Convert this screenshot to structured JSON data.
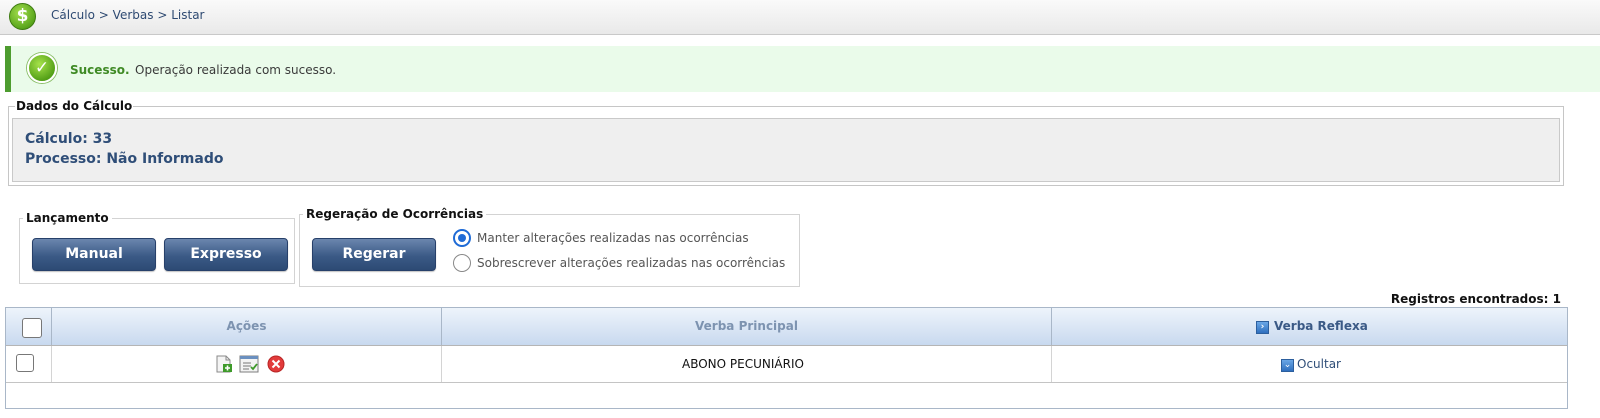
{
  "breadcrumb": {
    "items": [
      "Cálculo",
      "Verbas",
      "Listar"
    ],
    "separator": ">"
  },
  "alert": {
    "title": "Sucesso.",
    "message": "Operação realizada com sucesso."
  },
  "dados": {
    "legend": "Dados do Cálculo",
    "calculo": "Cálculo: 33",
    "processo": "Processo: Não Informado"
  },
  "lancamento": {
    "legend": "Lançamento",
    "manual": "Manual",
    "expresso": "Expresso"
  },
  "regeracao": {
    "legend": "Regeração de Ocorrências",
    "button": "Regerar",
    "options": [
      {
        "label": "Manter alterações realizadas nas ocorrências",
        "checked": true
      },
      {
        "label": "Sobrescrever alterações realizadas nas ocorrências",
        "checked": false
      }
    ]
  },
  "registros": "Registros encontrados: 1",
  "table": {
    "headers": {
      "acoes": "Ações",
      "principal": "Verba Principal",
      "reflexa": "Verba Reflexa"
    },
    "rows": [
      {
        "principal": "ABONO PECUNIÁRIO",
        "reflexa_link": "Ocultar"
      }
    ]
  },
  "colors": {
    "accent": "#3b5a86",
    "success": "#4d9c2f",
    "success_bg": "#eafbea"
  },
  "icons": [
    "money-logo-icon",
    "success-check-icon",
    "edit-document-icon",
    "checklist-icon",
    "delete-icon",
    "expand-arrow-icon",
    "collapse-arrow-icon"
  ]
}
